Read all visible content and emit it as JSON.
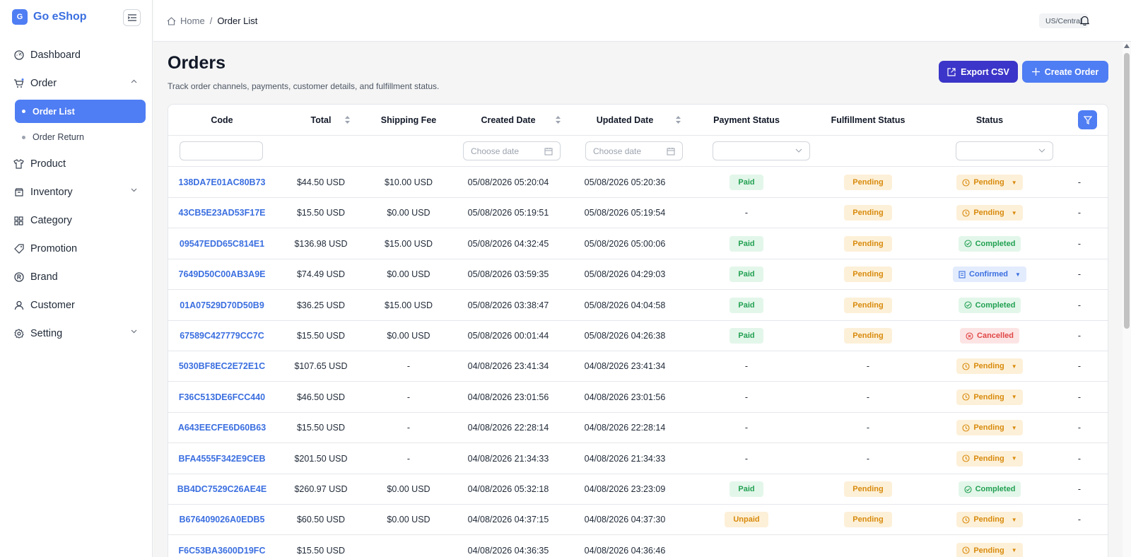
{
  "brand": {
    "logo_letter": "G",
    "name": "Go eShop"
  },
  "sidebar": {
    "items": [
      {
        "label": "Dashboard",
        "icon": "dashboard-icon"
      },
      {
        "label": "Order",
        "icon": "cart-icon",
        "expanded": true,
        "children": [
          {
            "label": "Order List",
            "active": true
          },
          {
            "label": "Order Return"
          }
        ]
      },
      {
        "label": "Product",
        "icon": "shirt-icon"
      },
      {
        "label": "Inventory",
        "icon": "inventory-icon",
        "expandable": true
      },
      {
        "label": "Category",
        "icon": "grid-icon"
      },
      {
        "label": "Promotion",
        "icon": "tag-icon"
      },
      {
        "label": "Brand",
        "icon": "brand-icon"
      },
      {
        "label": "Customer",
        "icon": "user-icon"
      },
      {
        "label": "Setting",
        "icon": "gear-icon",
        "expandable": true
      }
    ]
  },
  "header": {
    "breadcrumb": {
      "home": "Home",
      "separator": "/",
      "current": "Order List"
    },
    "timezone": "US/Central"
  },
  "page": {
    "title": "Orders",
    "subtitle": "Track order channels, payments, customer details, and fulfillment status.",
    "export_label": "Export CSV",
    "create_label": "Create Order"
  },
  "table": {
    "columns": [
      "Code",
      "Total",
      "Shipping Fee",
      "Created Date",
      "Updated Date",
      "Payment Status",
      "Fulfillment Status",
      "Status"
    ],
    "filters": {
      "created_placeholder": "Choose date",
      "updated_placeholder": "Choose date"
    },
    "rows": [
      {
        "code": "138DA7E01AC80B73",
        "total": "$44.50 USD",
        "shipping": "$10.00 USD",
        "created": "05/08/2026 05:20:04",
        "updated": "05/08/2026 05:20:36",
        "payment": "Paid",
        "fulfillment": "Pending",
        "status": "Pending",
        "action": "-"
      },
      {
        "code": "43CB5E23AD53F17E",
        "total": "$15.50 USD",
        "shipping": "$0.00 USD",
        "created": "05/08/2026 05:19:51",
        "updated": "05/08/2026 05:19:54",
        "payment": "-",
        "fulfillment": "Pending",
        "status": "Pending",
        "action": "-"
      },
      {
        "code": "09547EDD65C814E1",
        "total": "$136.98 USD",
        "shipping": "$15.00 USD",
        "created": "05/08/2026 04:32:45",
        "updated": "05/08/2026 05:00:06",
        "payment": "Paid",
        "fulfillment": "Pending",
        "status": "Completed",
        "action": "-"
      },
      {
        "code": "7649D50C00AB3A9E",
        "total": "$74.49 USD",
        "shipping": "$0.00 USD",
        "created": "05/08/2026 03:59:35",
        "updated": "05/08/2026 04:29:03",
        "payment": "Paid",
        "fulfillment": "Pending",
        "status": "Confirmed",
        "action": "-"
      },
      {
        "code": "01A07529D70D50B9",
        "total": "$36.25 USD",
        "shipping": "$15.00 USD",
        "created": "05/08/2026 03:38:47",
        "updated": "05/08/2026 04:04:58",
        "payment": "Paid",
        "fulfillment": "Pending",
        "status": "Completed",
        "action": "-"
      },
      {
        "code": "67589C427779CC7C",
        "total": "$15.50 USD",
        "shipping": "$0.00 USD",
        "created": "05/08/2026 00:01:44",
        "updated": "05/08/2026 04:26:38",
        "payment": "Paid",
        "fulfillment": "Pending",
        "status": "Cancelled",
        "action": "-"
      },
      {
        "code": "5030BF8EC2E72E1C",
        "total": "$107.65 USD",
        "shipping": "-",
        "created": "04/08/2026 23:41:34",
        "updated": "04/08/2026 23:41:34",
        "payment": "-",
        "fulfillment": "-",
        "status": "Pending",
        "action": "-"
      },
      {
        "code": "F36C513DE6FCC440",
        "total": "$46.50 USD",
        "shipping": "-",
        "created": "04/08/2026 23:01:56",
        "updated": "04/08/2026 23:01:56",
        "payment": "-",
        "fulfillment": "-",
        "status": "Pending",
        "action": "-"
      },
      {
        "code": "A643EECFE6D60B63",
        "total": "$15.50 USD",
        "shipping": "-",
        "created": "04/08/2026 22:28:14",
        "updated": "04/08/2026 22:28:14",
        "payment": "-",
        "fulfillment": "-",
        "status": "Pending",
        "action": "-"
      },
      {
        "code": "BFA4555F342E9CEB",
        "total": "$201.50 USD",
        "shipping": "-",
        "created": "04/08/2026 21:34:33",
        "updated": "04/08/2026 21:34:33",
        "payment": "-",
        "fulfillment": "-",
        "status": "Pending",
        "action": "-"
      },
      {
        "code": "BB4DC7529C26AE4E",
        "total": "$260.97 USD",
        "shipping": "$0.00 USD",
        "created": "04/08/2026 05:32:18",
        "updated": "04/08/2026 23:23:09",
        "payment": "Paid",
        "fulfillment": "Pending",
        "status": "Completed",
        "action": "-"
      },
      {
        "code": "B676409026A0EDB5",
        "total": "$60.50 USD",
        "shipping": "$0.00 USD",
        "created": "04/08/2026 04:37:15",
        "updated": "04/08/2026 04:37:30",
        "payment": "Unpaid",
        "fulfillment": "Pending",
        "status": "Pending",
        "action": "-"
      },
      {
        "code": "F6C53BA3600D19FC",
        "total": "$15.50 USD",
        "shipping": "",
        "created": "04/08/2026 04:36:35",
        "updated": "04/08/2026 04:36:46",
        "payment": "",
        "fulfillment": "",
        "status": "Pending",
        "action": ""
      }
    ]
  },
  "colors": {
    "accent": "#4f7df3",
    "export": "#3b35c9",
    "link": "#3b6fe0"
  }
}
